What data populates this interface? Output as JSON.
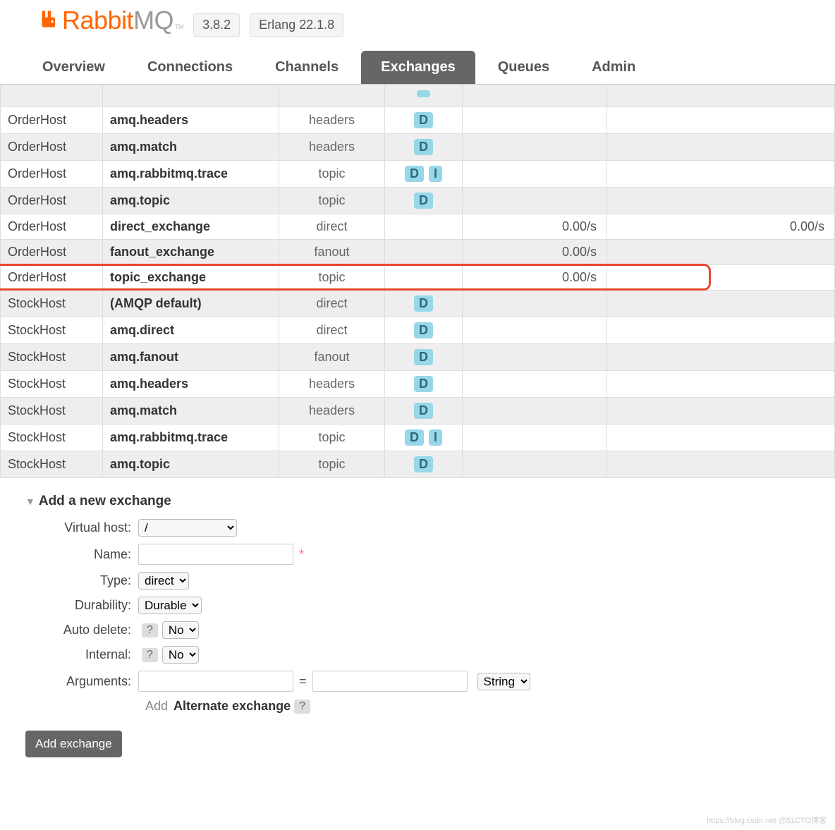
{
  "header": {
    "product": "Rabbit",
    "product_suffix": "MQ",
    "tm": "TM",
    "version": "3.8.2",
    "erlang": "Erlang 22.1.8"
  },
  "tabs": [
    {
      "label": "Overview",
      "active": false
    },
    {
      "label": "Connections",
      "active": false
    },
    {
      "label": "Channels",
      "active": false
    },
    {
      "label": "Exchanges",
      "active": true
    },
    {
      "label": "Queues",
      "active": false
    },
    {
      "label": "Admin",
      "active": false
    }
  ],
  "exchanges": [
    {
      "vhost": "OrderHost",
      "name": "amq.headers",
      "type": "headers",
      "features": [
        "D"
      ],
      "rate_in": "",
      "rate_out": ""
    },
    {
      "vhost": "OrderHost",
      "name": "amq.match",
      "type": "headers",
      "features": [
        "D"
      ],
      "rate_in": "",
      "rate_out": ""
    },
    {
      "vhost": "OrderHost",
      "name": "amq.rabbitmq.trace",
      "type": "topic",
      "features": [
        "D",
        "I"
      ],
      "rate_in": "",
      "rate_out": ""
    },
    {
      "vhost": "OrderHost",
      "name": "amq.topic",
      "type": "topic",
      "features": [
        "D"
      ],
      "rate_in": "",
      "rate_out": ""
    },
    {
      "vhost": "OrderHost",
      "name": "direct_exchange",
      "type": "direct",
      "features": [],
      "rate_in": "0.00/s",
      "rate_out": "0.00/s"
    },
    {
      "vhost": "OrderHost",
      "name": "fanout_exchange",
      "type": "fanout",
      "features": [],
      "rate_in": "0.00/s",
      "rate_out": ""
    },
    {
      "vhost": "OrderHost",
      "name": "topic_exchange",
      "type": "topic",
      "features": [],
      "rate_in": "0.00/s",
      "rate_out": "",
      "highlighted": true
    },
    {
      "vhost": "StockHost",
      "name": "(AMQP default)",
      "type": "direct",
      "features": [
        "D"
      ],
      "rate_in": "",
      "rate_out": ""
    },
    {
      "vhost": "StockHost",
      "name": "amq.direct",
      "type": "direct",
      "features": [
        "D"
      ],
      "rate_in": "",
      "rate_out": ""
    },
    {
      "vhost": "StockHost",
      "name": "amq.fanout",
      "type": "fanout",
      "features": [
        "D"
      ],
      "rate_in": "",
      "rate_out": ""
    },
    {
      "vhost": "StockHost",
      "name": "amq.headers",
      "type": "headers",
      "features": [
        "D"
      ],
      "rate_in": "",
      "rate_out": ""
    },
    {
      "vhost": "StockHost",
      "name": "amq.match",
      "type": "headers",
      "features": [
        "D"
      ],
      "rate_in": "",
      "rate_out": ""
    },
    {
      "vhost": "StockHost",
      "name": "amq.rabbitmq.trace",
      "type": "topic",
      "features": [
        "D",
        "I"
      ],
      "rate_in": "",
      "rate_out": ""
    },
    {
      "vhost": "StockHost",
      "name": "amq.topic",
      "type": "topic",
      "features": [
        "D"
      ],
      "rate_in": "",
      "rate_out": ""
    }
  ],
  "add_section": {
    "title": "Add a new exchange",
    "vhost_label": "Virtual host:",
    "vhost_value": "/",
    "name_label": "Name:",
    "name_value": "",
    "required_mark": "*",
    "type_label": "Type:",
    "type_value": "direct",
    "durability_label": "Durability:",
    "durability_value": "Durable",
    "autodelete_label": "Auto delete:",
    "autodelete_value": "No",
    "internal_label": "Internal:",
    "internal_value": "No",
    "arguments_label": "Arguments:",
    "arg_key": "",
    "arg_eq": "=",
    "arg_val": "",
    "arg_type": "String",
    "help": "?",
    "add_hint": "Add",
    "alt_exchange": "Alternate exchange",
    "submit": "Add exchange"
  },
  "watermark": "https://blog.csdn.net  @51CTO博客"
}
